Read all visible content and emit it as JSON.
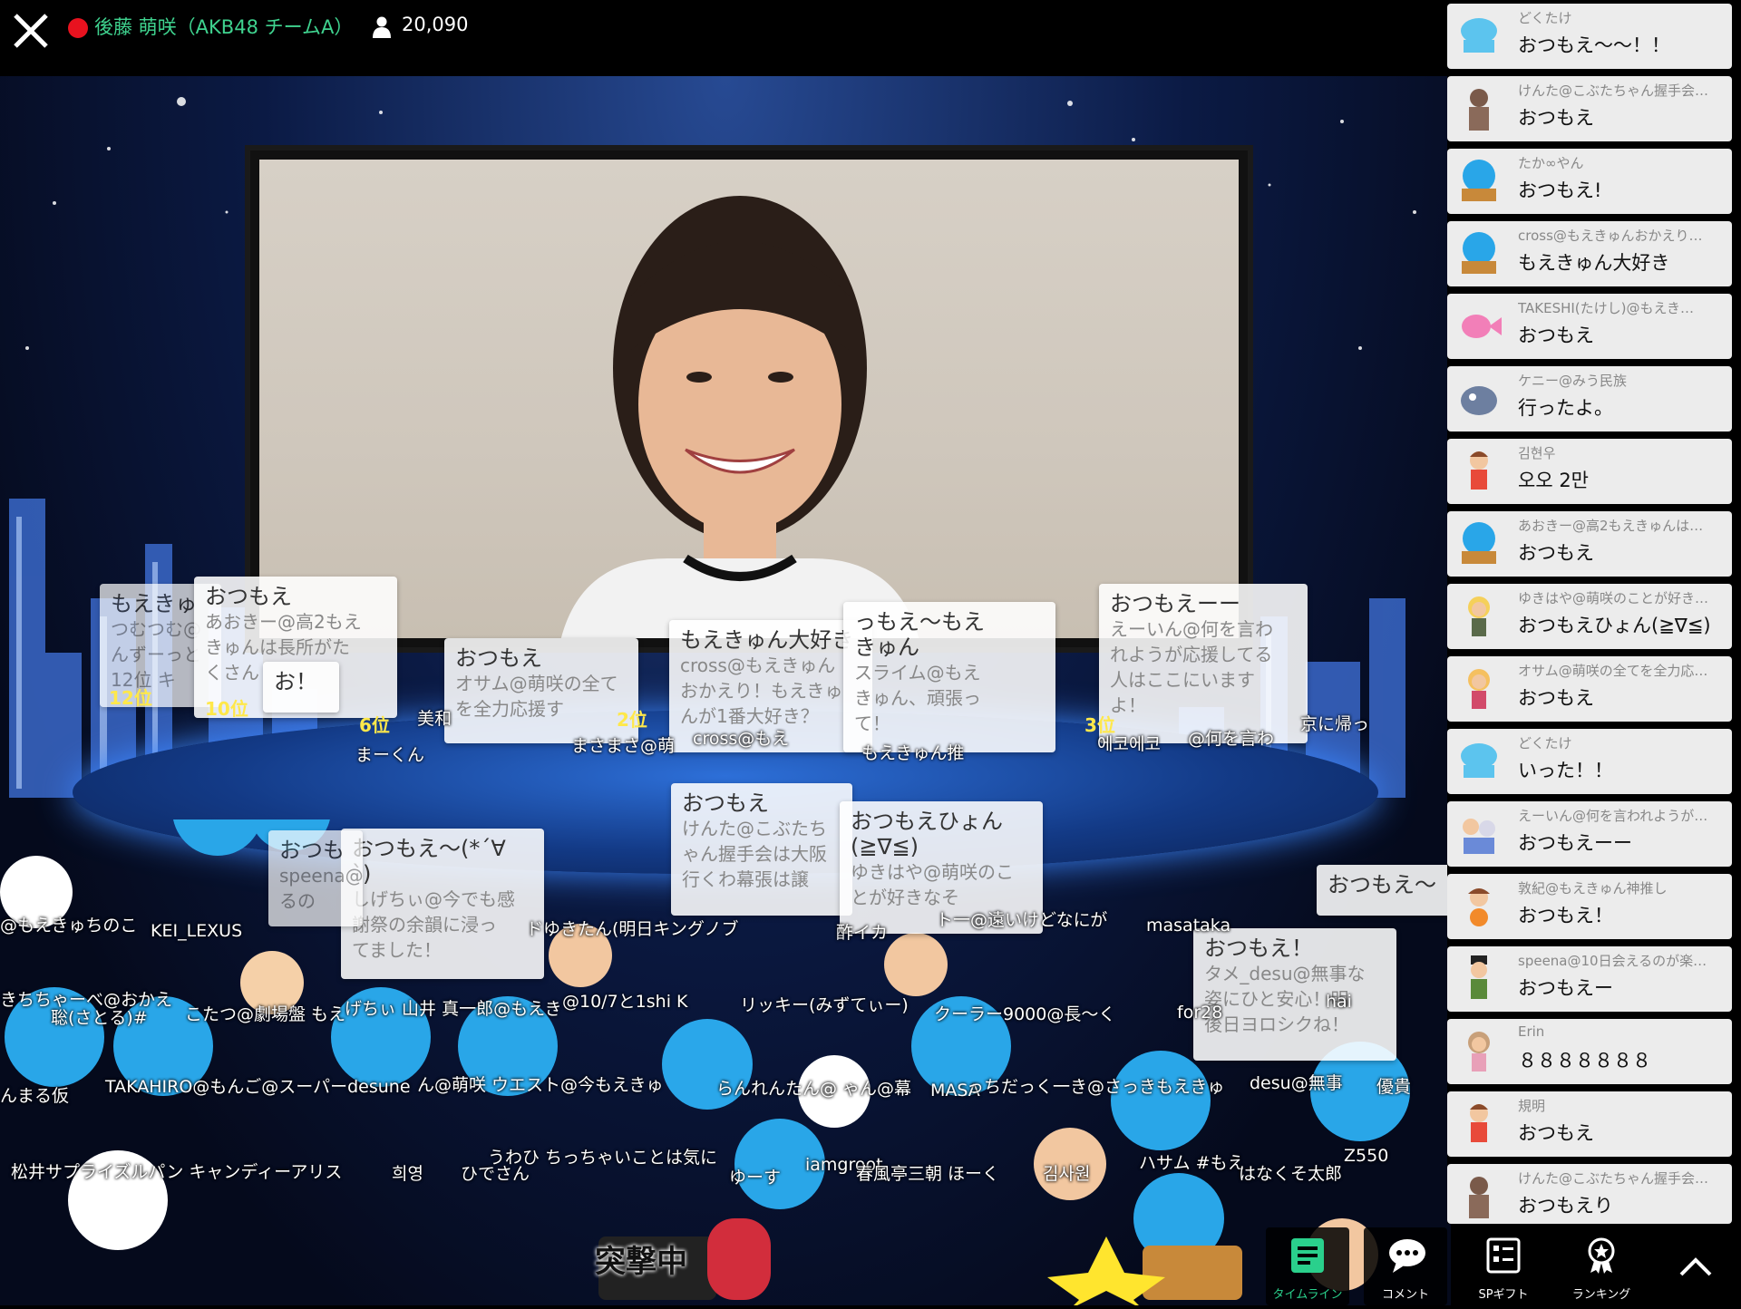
{
  "header": {
    "streamer_name": "後藤 萌咲（AKB48 チームA）",
    "viewer_count": "20,090",
    "live_color": "#e8121f",
    "accent_color": "#3fd38f"
  },
  "floating_comments": [
    {
      "title": "もえきゅ",
      "sub": "つむつむ@\nんずーっと\n12位 キ"
    },
    {
      "title": "おつもえ",
      "sub": "あおきー@高2もえ\nきゅんは長所がた\nくさん"
    },
    {
      "title": "お！",
      "sub": ""
    },
    {
      "title": "おつもえ",
      "sub": "オサム@萌咲の全て\nを全力応援す"
    },
    {
      "title": "もえきゅん大好き",
      "sub": "cross@もえきゅん\nおかえり！もえきゅ\nんが1番大好き？"
    },
    {
      "title": "っもえ〜もえ\nきゅん",
      "sub": "スライム@もえ\nきゅん、頑張っ\nて！"
    },
    {
      "title": "おつもえーー",
      "sub": "えーいん@何を言わ\nれようが応援してる\n人はここにいます\nよ！"
    },
    {
      "title": "おつもえ",
      "sub": "けんた@こぶたち\nゃん握手会は大阪\n行くわ幕張は譲"
    },
    {
      "title": "おつもえひょん\n(≧∇≦)",
      "sub": "ゆきはや@萌咲のこ\nとが好きなそ"
    },
    {
      "title": "おつもえ〜(*´∀\n`)",
      "sub": "しげちぃ@今でも感\n謝祭の余韻に浸っ\nてました！"
    },
    {
      "title": "おつもえ！",
      "sub": "タメ_desu@無事な\n姿にひと安心！明\n後日ヨロシクね！"
    },
    {
      "title": "おつもえ〜",
      "sub": ""
    },
    {
      "title": "おつも",
      "sub": "speena@\nるの"
    }
  ],
  "ranks": [
    "12位",
    "10位",
    "6位",
    "2位",
    "3位"
  ],
  "name_tags": [
    "@もえきゅちのこ",
    "KEI_LEXUS",
    "まーくん",
    "美和",
    "まさまさ@萌",
    "cross@もえ",
    "もえきゅん推",
    "ドゆきたん(明日キングノブ",
    "酢イカ",
    "ト一@遠いけどなにが",
    "masataka",
    "きちちゃーべ@おかえ",
    "聡(さとる)#",
    "こたつ@劇場盤 もえ",
    "げちぃ 山井 真一郎@もえき",
    "@10/7と1shi K",
    "リッキー(みずてぃー)",
    "クーラー9000@長〜く",
    "for28",
    "hai",
    "んまる仮",
    "TAKAHIRO@もんご@スーパーdesune",
    "ん@萌咲 ウエスト@今もえきゅ",
    "らんれんたん@ ゃん@幕",
    "MASA",
    "っちだっく一き@さっきもえきゅ",
    "desu@無事",
    "優貴",
    "松井サプライズルパン キャンディーアリス",
    "희영",
    "ひでさん",
    "うわひ ちっちゃいことは気に",
    "ゆーす",
    "iamgroot",
    "春風亭三朝 ほーく",
    "김사원",
    "ハサム #もえ",
    "Z550",
    "はなくそ太郎",
    "京に帰っ",
    "@何を言わ",
    "에코에코",
    "突撃中"
  ],
  "timeline": [
    {
      "name": "どくたけ",
      "text": "おつもえ〜〜！！"
    },
    {
      "name": "けんた@こぶたちゃん握手会…",
      "text": "おつもえ"
    },
    {
      "name": "たか∞やん",
      "text": "おつもえ!"
    },
    {
      "name": "cross@もえきゅんおかえり…",
      "text": "もえきゅん大好き"
    },
    {
      "name": "TAKESHI(たけし)@もえき…",
      "text": "おつもえ"
    },
    {
      "name": "ケニー@みう民族",
      "text": "行ったよ。"
    },
    {
      "name": "김현우",
      "text": "오오 2만"
    },
    {
      "name": "あおきー@高2もえきゅんは…",
      "text": "おつもえ"
    },
    {
      "name": "ゆきはや@萌咲のことが好き…",
      "text": "おつもえひょん(≧∇≦)"
    },
    {
      "name": "オサム@萌咲の全てを全力応…",
      "text": "おつもえ"
    },
    {
      "name": "どくたけ",
      "text": "いった！！"
    },
    {
      "name": "えーいん@何を言われようが…",
      "text": "おつもえーー"
    },
    {
      "name": "敦紀@もえきゅん神推し",
      "text": "おつもえ！"
    },
    {
      "name": "speena@10日会えるのが楽…",
      "text": "おつもえー"
    },
    {
      "name": "Erin",
      "text": "８８８８８８８"
    },
    {
      "name": "規明",
      "text": "おつもえ"
    },
    {
      "name": "けんた@こぶたちゃん握手会…",
      "text": "おつもえり"
    }
  ],
  "nav": {
    "timeline_label": "タイムライン",
    "comment_label": "コメント",
    "spgift_label": "SPギフト",
    "ranking_label": "ランキング",
    "active_color": "#2ad08c"
  }
}
